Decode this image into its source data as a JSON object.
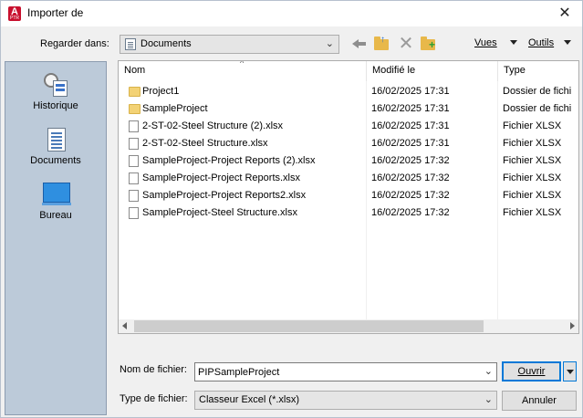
{
  "window": {
    "title": "Importer de",
    "close_glyph": "✕",
    "app_icon_letter": "A",
    "app_icon_sub": "PTR"
  },
  "lookin": {
    "label": "Regarder dans:",
    "value": "Documents"
  },
  "toolbar": {
    "views_label": "Vues",
    "tools_label": "Outils"
  },
  "places": [
    {
      "label": "Historique",
      "icon": "history-icon"
    },
    {
      "label": "Documents",
      "icon": "documents-icon"
    },
    {
      "label": "Bureau",
      "icon": "desktop-icon"
    }
  ],
  "filelist": {
    "columns": {
      "name": "Nom",
      "modified": "Modifié le",
      "type": "Type"
    },
    "rows": [
      {
        "name": "Project1",
        "modified": "16/02/2025 17:31",
        "type": "Dossier de fichi",
        "kind": "folder"
      },
      {
        "name": "SampleProject",
        "modified": "16/02/2025 17:31",
        "type": "Dossier de fichi",
        "kind": "folder"
      },
      {
        "name": "2-ST-02-Steel Structure (2).xlsx",
        "modified": "16/02/2025 17:31",
        "type": "Fichier XLSX",
        "kind": "file"
      },
      {
        "name": "2-ST-02-Steel Structure.xlsx",
        "modified": "16/02/2025 17:31",
        "type": "Fichier XLSX",
        "kind": "file"
      },
      {
        "name": "SampleProject-Project Reports (2).xlsx",
        "modified": "16/02/2025 17:32",
        "type": "Fichier XLSX",
        "kind": "file"
      },
      {
        "name": "SampleProject-Project Reports.xlsx",
        "modified": "16/02/2025 17:32",
        "type": "Fichier XLSX",
        "kind": "file"
      },
      {
        "name": "SampleProject-Project Reports2.xlsx",
        "modified": "16/02/2025 17:32",
        "type": "Fichier XLSX",
        "kind": "file"
      },
      {
        "name": "SampleProject-Steel Structure.xlsx",
        "modified": "16/02/2025 17:32",
        "type": "Fichier XLSX",
        "kind": "file"
      }
    ]
  },
  "filename": {
    "label": "Nom de fichier:",
    "value": "PIPSampleProject"
  },
  "filetype": {
    "label": "Type de fichier:",
    "value": "Classeur Excel (*.xlsx)"
  },
  "buttons": {
    "open": "Ouvrir",
    "cancel": "Annuler"
  }
}
